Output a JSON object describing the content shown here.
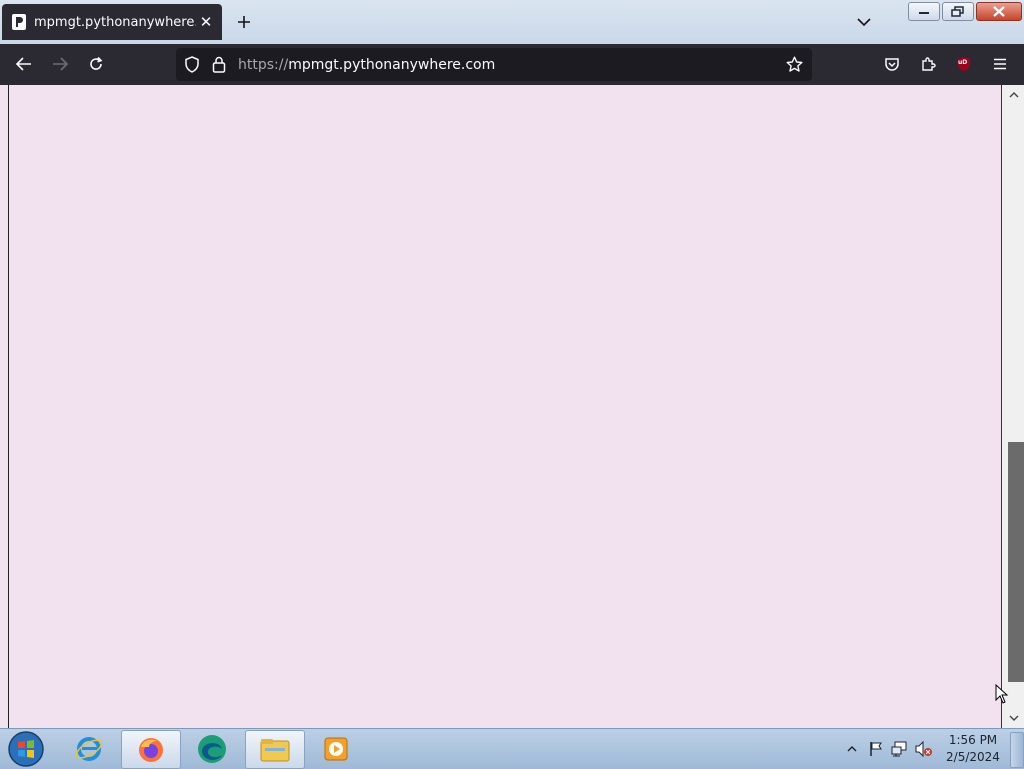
{
  "browser": {
    "tab": {
      "title": "mpmgt.pythonanywhere.com/",
      "favicon": "pythonanywhere-favicon",
      "close_icon": "close-icon"
    },
    "new_tab_icon": "plus-icon",
    "tab_list_icon": "chevron-down-icon",
    "window_controls": [
      "minimize-icon",
      "restore-icon",
      "close-icon"
    ],
    "nav": {
      "back_icon": "back-arrow-icon",
      "forward_icon": "forward-arrow-icon",
      "reload_icon": "reload-icon",
      "url_scheme": "https://",
      "url_host": "mpmgt.pythonanywhere.com",
      "bookmark_icon": "star-icon",
      "pocket_icon": "pocket-icon",
      "extensions_icon": "puzzle-icon",
      "ublock_label": "uD",
      "menu_icon": "hamburger-menu-icon"
    }
  },
  "page": {
    "background_color": "#f2e2f0"
  },
  "taskbar": {
    "apps": [
      "internet-explorer-icon",
      "firefox-icon",
      "edge-icon",
      "file-explorer-icon",
      "media-player-icon"
    ],
    "active_app": "firefox-icon",
    "tray_icons": [
      "show-hidden-icons-icon",
      "action-center-flag-icon",
      "network-icon",
      "volume-muted-icon"
    ],
    "time": "1:56 PM",
    "date": "2/5/2024"
  },
  "colors": {
    "tab_bg": "#2b2a33",
    "toolbar_bg": "#2b2a33",
    "urlbar_bg": "#1c1b22",
    "ublock_red": "#a3001b"
  }
}
